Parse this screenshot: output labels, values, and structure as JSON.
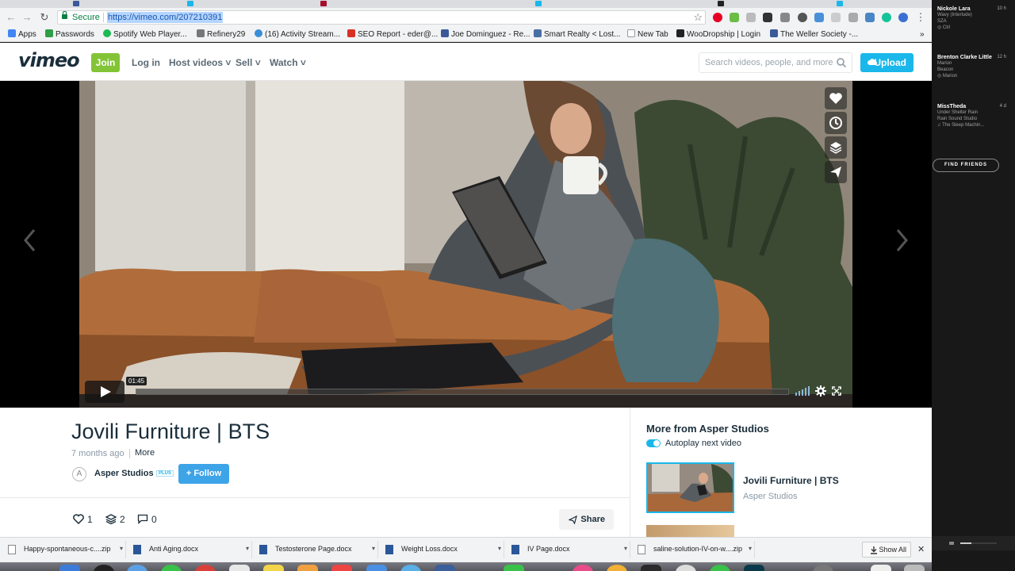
{
  "browser": {
    "url": "https://vimeo.com/207210391",
    "secure_label": "Secure",
    "bookmarks": [
      {
        "label": "Apps"
      },
      {
        "label": "Passwords"
      },
      {
        "label": "Spotify Web Player..."
      },
      {
        "label": "Refinery29"
      },
      {
        "label": "(16) Activity Stream..."
      },
      {
        "label": "SEO Report - eder@..."
      },
      {
        "label": "Joe Dominguez - Re..."
      },
      {
        "label": "Smart Realty < Lost..."
      },
      {
        "label": "New Tab"
      },
      {
        "label": "WooDropship | Login"
      },
      {
        "label": "The Weller Society -..."
      }
    ],
    "bookmarks_overflow": "»"
  },
  "vimeo": {
    "logo": "vimeo",
    "join": "Join",
    "login": "Log in",
    "nav": [
      "Host videos",
      "Sell",
      "Watch"
    ],
    "search_placeholder": "Search videos, people, and more",
    "upload": "Upload"
  },
  "player": {
    "time": "01:45"
  },
  "video": {
    "title": "Jovili Furniture | BTS",
    "age": "7 months ago",
    "more": "More",
    "author": "Asper Studios",
    "badge": "PLUS",
    "follow": "+ Follow",
    "likes": "1",
    "collections": "2",
    "comments": "0",
    "share": "Share"
  },
  "sidebar": {
    "heading": "More from Asper Studios",
    "autoplay": "Autoplay next video",
    "related": [
      {
        "title": "Jovili Furniture | BTS",
        "author": "Asper Studios"
      }
    ]
  },
  "downloads": {
    "items": [
      {
        "name": "Happy-spontaneous-c....zip"
      },
      {
        "name": "Anti Aging.docx"
      },
      {
        "name": "Testosterone Page.docx"
      },
      {
        "name": "Weight Loss.docx"
      },
      {
        "name": "IV Page.docx"
      },
      {
        "name": "saline-solution-IV-on-w....zip"
      }
    ],
    "show_all": "Show All"
  },
  "friends": {
    "items": [
      {
        "name": "Nickole Lara",
        "time": "10 h",
        "track": "Wavy (Interlude)",
        "artist": "SZA",
        "context": "Ctrl"
      },
      {
        "name": "Brenton Clarke Little",
        "time": "12 h",
        "track": "Marion",
        "artist": "Beacon",
        "context": "Marion"
      },
      {
        "name": "MissTheda",
        "time": "4 d",
        "track": "Under Shelter Rain",
        "artist": "Rain Sound Studio",
        "context": "The Sleep Machin..."
      }
    ],
    "find_friends": "FIND FRIENDS"
  },
  "colors": {
    "vimeo_blue": "#1ab7ea",
    "join_green": "#83c436",
    "title_navy": "#1a2e3b"
  }
}
